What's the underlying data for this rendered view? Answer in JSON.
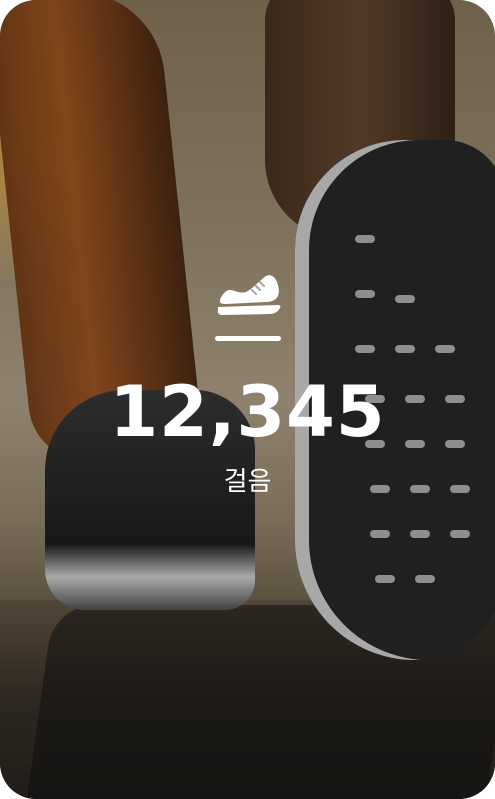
{
  "widget": {
    "icon": "sneaker-icon",
    "step_count": "12,345",
    "step_label": "걸음",
    "text_color": "#ffffff"
  }
}
